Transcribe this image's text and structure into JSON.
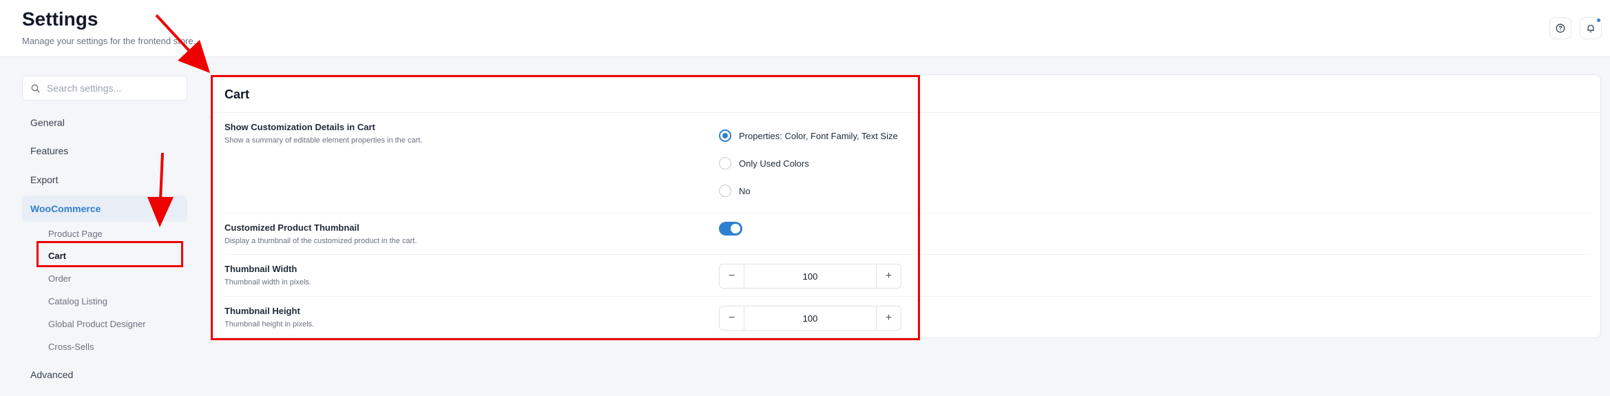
{
  "header": {
    "title": "Settings",
    "subtitle": "Manage your settings for the frontend store.",
    "help_icon": "help-circle-icon",
    "bell_icon": "bell-icon"
  },
  "sidebar": {
    "search_placeholder": "Search settings...",
    "items": [
      {
        "label": "General"
      },
      {
        "label": "Features"
      },
      {
        "label": "Export"
      },
      {
        "label": "WooCommerce",
        "active": true
      },
      {
        "label": "Advanced"
      }
    ],
    "subitems": [
      {
        "label": "Product Page"
      },
      {
        "label": "Cart",
        "active": true
      },
      {
        "label": "Order"
      },
      {
        "label": "Catalog Listing"
      },
      {
        "label": "Global Product Designer"
      },
      {
        "label": "Cross-Sells"
      }
    ]
  },
  "panel": {
    "title": "Cart",
    "settings": {
      "customization": {
        "label": "Show Customization Details in Cart",
        "description": "Show a summary of editable element properties in the cart.",
        "options": [
          {
            "label": "Properties: Color, Font Family, Text Size",
            "checked": true
          },
          {
            "label": "Only Used Colors",
            "checked": false
          },
          {
            "label": "No",
            "checked": false
          }
        ]
      },
      "thumbnail": {
        "label": "Customized Product Thumbnail",
        "description": "Display a thumbnail of the customized product in the cart.",
        "enabled": true
      },
      "width": {
        "label": "Thumbnail Width",
        "description": "Thumbnail width in pixels.",
        "value": "100"
      },
      "height": {
        "label": "Thumbnail Height",
        "description": "Thumbnail height in pixels.",
        "value": "100"
      }
    }
  },
  "colors": {
    "accent": "#2f80d0",
    "annotation": "#ee0000"
  }
}
